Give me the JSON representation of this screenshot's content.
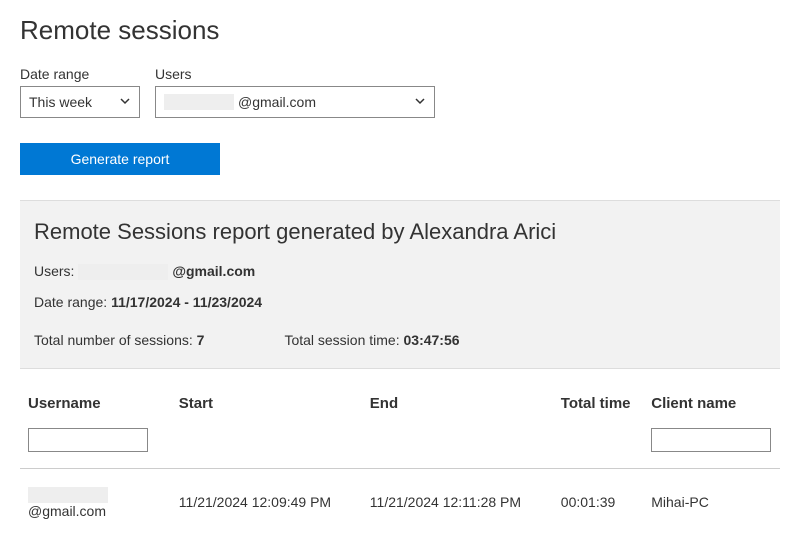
{
  "page": {
    "title": "Remote sessions"
  },
  "filters": {
    "date_range_label": "Date range",
    "date_range_value": "This week",
    "users_label": "Users",
    "users_value_prefix": "",
    "users_value_suffix": "@gmail.com"
  },
  "actions": {
    "generate_report": "Generate report"
  },
  "report": {
    "title": "Remote Sessions report generated by Alexandra Arici",
    "users_label": "Users:",
    "users_value_suffix": "@gmail.com",
    "date_range_label": "Date range:",
    "date_range_value": "11/17/2024 - 11/23/2024",
    "total_sessions_label": "Total number of sessions:",
    "total_sessions_value": "7",
    "total_time_label": "Total session time:",
    "total_time_value": "03:47:56"
  },
  "table": {
    "headers": {
      "username": "Username",
      "start": "Start",
      "end": "End",
      "total_time": "Total time",
      "client_name": "Client name"
    },
    "rows": [
      {
        "username_suffix": "@gmail.com",
        "start": "11/21/2024 12:09:49 PM",
        "end": "11/21/2024 12:11:28 PM",
        "total_time": "00:01:39",
        "client_name": "Mihai-PC"
      }
    ]
  }
}
